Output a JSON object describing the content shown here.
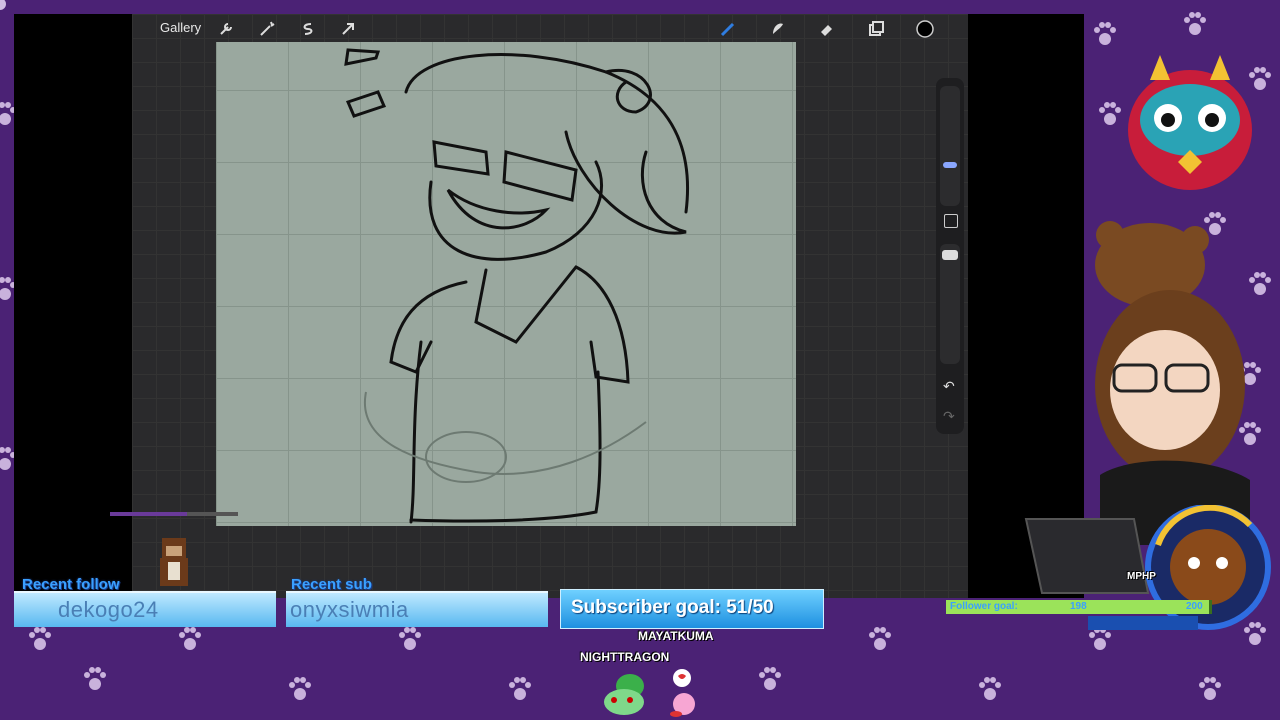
{
  "app": {
    "gallery_label": "Gallery",
    "toolbar_icons": [
      "wrench-icon",
      "magic-wand-icon",
      "selection-s-icon",
      "transform-arrow-icon",
      "brush-icon",
      "smudge-icon",
      "eraser-icon",
      "layers-icon",
      "color-swatch-icon"
    ],
    "accent": "#2f7de1"
  },
  "overlay": {
    "recent_follow": {
      "label": "Recent follow",
      "value": "dekogo24"
    },
    "recent_sub": {
      "label": "Recent sub",
      "value": "onyxsiwmia"
    },
    "subscriber_goal": "Subscriber goal: 51/50",
    "follower_goal": {
      "label": "Follower goal:",
      "current": "198",
      "target": "200",
      "progress": 0.99
    },
    "chat_names": [
      "MAYATKUMA",
      "NIGHTTRAGON"
    ],
    "hud_label": "MPHP"
  }
}
